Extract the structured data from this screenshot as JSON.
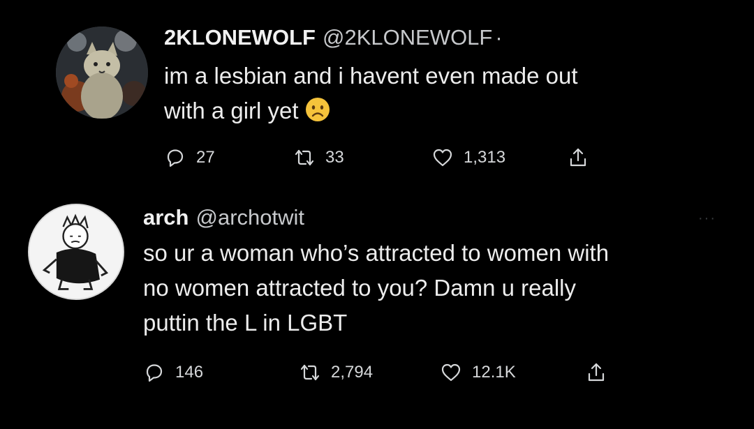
{
  "tweets": [
    {
      "display_name": "2KLONEWOLF",
      "handle": "@2KLONEWOLF",
      "separator": "·",
      "text_lines": [
        "im a lesbian and i havent even made out",
        "with a girl yet"
      ],
      "emoji": "frowning-face",
      "replies": "27",
      "retweets": "33",
      "likes": "1,313"
    },
    {
      "display_name": "arch",
      "handle": "@archotwit",
      "text_lines": [
        "so ur a woman who’s attracted to women with",
        "no women attracted to you? Damn u really",
        "puttin the L in LGBT"
      ],
      "replies": "146",
      "retweets": "2,794",
      "likes": "12.1K"
    }
  ],
  "colors": {
    "background": "#000000",
    "text": "#e7e9ea",
    "icon": "#d6d8da",
    "emoji": "#f5c33b"
  }
}
